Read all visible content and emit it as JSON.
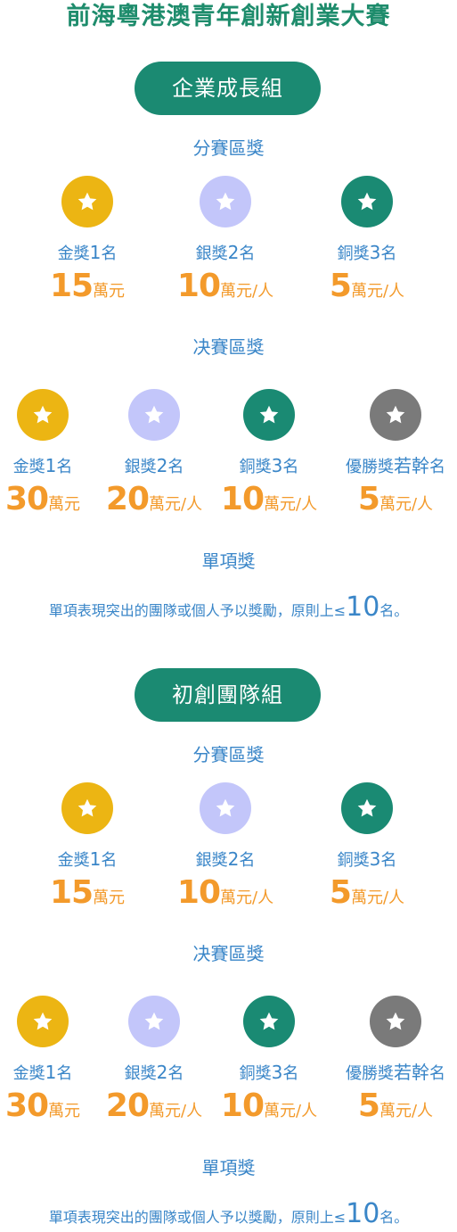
{
  "title": "前海粵港澳青年創新創業大賽",
  "colors": {
    "gold": "#ecb513",
    "silver": "#c3c6fa",
    "bronze": "#1a8a73",
    "merit": "#7a7a7a",
    "green_title": "#1e8c6c",
    "blue_text": "#3a86c8",
    "orange": "#f39a2b"
  },
  "groups": [
    {
      "name": "企業成長組",
      "division": {
        "label": "分賽區獎",
        "awards": [
          {
            "icon": "star-icon",
            "name": "金獎",
            "count": "1",
            "suffix": "名",
            "amount": "15",
            "unit": "萬元"
          },
          {
            "icon": "star-icon",
            "name": "銀獎",
            "count": "2",
            "suffix": "名",
            "amount": "10",
            "unit": "萬元/人"
          },
          {
            "icon": "star-icon",
            "name": "銅獎",
            "count": "3",
            "suffix": "名",
            "amount": "5",
            "unit": "萬元/人"
          }
        ]
      },
      "final": {
        "label": "决賽區獎",
        "awards": [
          {
            "icon": "star-icon",
            "name": "金獎",
            "count": "1",
            "suffix": "名",
            "amount": "30",
            "unit": "萬元"
          },
          {
            "icon": "star-icon",
            "name": "銀獎",
            "count": "2",
            "suffix": "名",
            "amount": "20",
            "unit": "萬元/人"
          },
          {
            "icon": "star-icon",
            "name": "銅獎",
            "count": "3",
            "suffix": "名",
            "amount": "10",
            "unit": "萬元/人"
          },
          {
            "icon": "star-icon",
            "name": "優勝獎",
            "count": "若幹",
            "suffix": "名",
            "amount": "5",
            "unit": "萬元/人"
          }
        ]
      },
      "single": {
        "label": "單項獎",
        "note_pre": "單項表現突出的團隊或個人予以獎勵，原則上≤",
        "note_num": "10",
        "note_post": "名。"
      }
    },
    {
      "name": "初創團隊組",
      "division": {
        "label": "分賽區獎",
        "awards": [
          {
            "icon": "star-icon",
            "name": "金獎",
            "count": "1",
            "suffix": "名",
            "amount": "15",
            "unit": "萬元"
          },
          {
            "icon": "star-icon",
            "name": "銀獎",
            "count": "2",
            "suffix": "名",
            "amount": "10",
            "unit": "萬元/人"
          },
          {
            "icon": "star-icon",
            "name": "銅獎",
            "count": "3",
            "suffix": "名",
            "amount": "5",
            "unit": "萬元/人"
          }
        ]
      },
      "final": {
        "label": "决賽區獎",
        "awards": [
          {
            "icon": "star-icon",
            "name": "金獎",
            "count": "1",
            "suffix": "名",
            "amount": "30",
            "unit": "萬元"
          },
          {
            "icon": "star-icon",
            "name": "銀獎",
            "count": "2",
            "suffix": "名",
            "amount": "20",
            "unit": "萬元/人"
          },
          {
            "icon": "star-icon",
            "name": "銅獎",
            "count": "3",
            "suffix": "名",
            "amount": "10",
            "unit": "萬元/人"
          },
          {
            "icon": "star-icon",
            "name": "優勝獎",
            "count": "若幹",
            "suffix": "名",
            "amount": "5",
            "unit": "萬元/人"
          }
        ]
      },
      "single": {
        "label": "單項獎",
        "note_pre": "單項表現突出的團隊或個人予以獎勵，原則上≤",
        "note_num": "10",
        "note_post": "名。"
      }
    }
  ]
}
